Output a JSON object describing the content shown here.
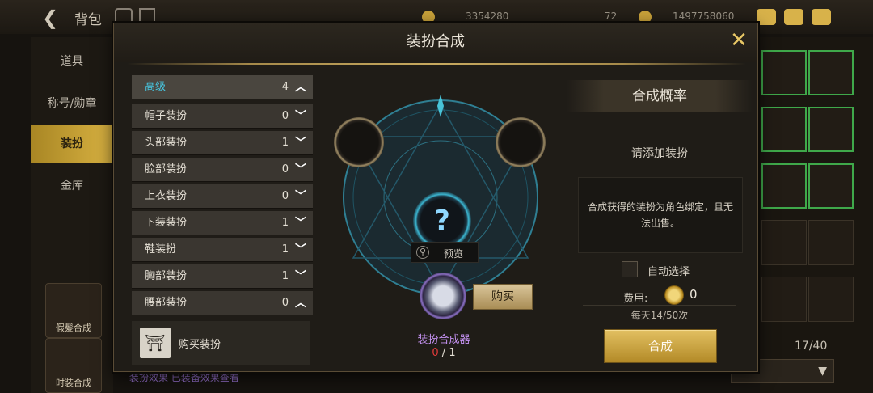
{
  "background": {
    "back_title": "背包",
    "currency_a": "3354280",
    "currency_b": "72",
    "currency_c": "1497758060",
    "sidebar": [
      {
        "label": "道具"
      },
      {
        "label": "称号/勋章"
      },
      {
        "label": "装扮"
      },
      {
        "label": "金库"
      }
    ],
    "tiles": [
      {
        "label": "假髮合成"
      },
      {
        "label": "时装合成"
      }
    ],
    "inventory_count": "17/40",
    "bottom_text": "装扮效果  已装备效果查看"
  },
  "dialog": {
    "title": "装扮合成",
    "categories": [
      {
        "label": "高级",
        "count": "4",
        "chev": "up"
      },
      {
        "label": "帽子装扮",
        "count": "0",
        "chev": "down"
      },
      {
        "label": "头部装扮",
        "count": "1",
        "chev": "down"
      },
      {
        "label": "脸部装扮",
        "count": "0",
        "chev": "down"
      },
      {
        "label": "上衣装扮",
        "count": "0",
        "chev": "down"
      },
      {
        "label": "下装装扮",
        "count": "1",
        "chev": "down"
      },
      {
        "label": "鞋装扮",
        "count": "1",
        "chev": "down"
      },
      {
        "label": "胸部装扮",
        "count": "1",
        "chev": "down"
      },
      {
        "label": "腰部装扮",
        "count": "0",
        "chev": "up"
      }
    ],
    "buy_dress_label": "购买装扮",
    "preview_label": "预览",
    "center_mark": "?",
    "synth_item_name": "装扮合成器",
    "synth_item_have": "0",
    "synth_item_sep": "/",
    "synth_item_need": "1",
    "buy_button": "购买",
    "probability_title": "合成概率",
    "probability_text": "请添加装扮",
    "bind_note": "合成获得的装扮为角色绑定，且无法出售。",
    "auto_select_label": "自动选择",
    "fee_label": "费用:",
    "fee_value": "0",
    "daily_limit": "每天14/50次",
    "synth_button": "合成"
  },
  "colors": {
    "accent_gold": "#d9b242",
    "active_blue": "#47c6e0",
    "item_purple": "#c592f2",
    "count_red": "#e03a3a"
  }
}
